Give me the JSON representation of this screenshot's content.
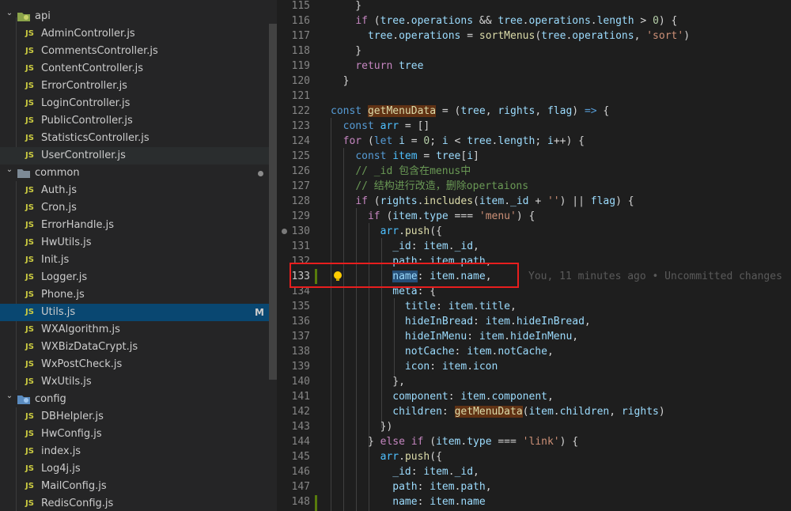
{
  "explorer": {
    "items": [
      {
        "type": "folder",
        "label": "api",
        "depth": 0,
        "icon": "api-folder-icon",
        "expanded": true
      },
      {
        "type": "file",
        "label": "AdminController.js",
        "depth": 1
      },
      {
        "type": "file",
        "label": "CommentsController.js",
        "depth": 1
      },
      {
        "type": "file",
        "label": "ContentController.js",
        "depth": 1
      },
      {
        "type": "file",
        "label": "ErrorController.js",
        "depth": 1
      },
      {
        "type": "file",
        "label": "LoginController.js",
        "depth": 1
      },
      {
        "type": "file",
        "label": "PublicController.js",
        "depth": 1
      },
      {
        "type": "file",
        "label": "StatisticsController.js",
        "depth": 1
      },
      {
        "type": "file",
        "label": "UserController.js",
        "depth": 1,
        "state": "hover"
      },
      {
        "type": "folder",
        "label": "common",
        "depth": 0,
        "icon": "folder-icon",
        "expanded": true,
        "modified_dot": true
      },
      {
        "type": "file",
        "label": "Auth.js",
        "depth": 1
      },
      {
        "type": "file",
        "label": "Cron.js",
        "depth": 1
      },
      {
        "type": "file",
        "label": "ErrorHandle.js",
        "depth": 1
      },
      {
        "type": "file",
        "label": "HwUtils.js",
        "depth": 1
      },
      {
        "type": "file",
        "label": "Init.js",
        "depth": 1
      },
      {
        "type": "file",
        "label": "Logger.js",
        "depth": 1
      },
      {
        "type": "file",
        "label": "Phone.js",
        "depth": 1
      },
      {
        "type": "file",
        "label": "Utils.js",
        "depth": 1,
        "state": "selected",
        "badge": "M"
      },
      {
        "type": "file",
        "label": "WXAlgorithm.js",
        "depth": 1
      },
      {
        "type": "file",
        "label": "WXBizDataCrypt.js",
        "depth": 1
      },
      {
        "type": "file",
        "label": "WxPostCheck.js",
        "depth": 1
      },
      {
        "type": "file",
        "label": "WxUtils.js",
        "depth": 1
      },
      {
        "type": "folder",
        "label": "config",
        "depth": 0,
        "icon": "config-folder-icon",
        "expanded": true
      },
      {
        "type": "file",
        "label": "DBHelpler.js",
        "depth": 1
      },
      {
        "type": "file",
        "label": "HwConfig.js",
        "depth": 1
      },
      {
        "type": "file",
        "label": "index.js",
        "depth": 1
      },
      {
        "type": "file",
        "label": "Log4j.js",
        "depth": 1
      },
      {
        "type": "file",
        "label": "MailConfig.js",
        "depth": 1
      },
      {
        "type": "file",
        "label": "RedisConfig.js",
        "depth": 1
      }
    ],
    "js_badge": "JS"
  },
  "editor": {
    "active_line": "133",
    "blame": "You, 11 minutes ago • Uncommitted changes",
    "lines": [
      {
        "n": "115",
        "t": [
          [
            "o",
            "    }"
          ]
        ]
      },
      {
        "n": "116",
        "t": [
          [
            "o",
            "    "
          ],
          [
            "k",
            "if"
          ],
          [
            "o",
            " ("
          ],
          [
            "v",
            "tree"
          ],
          [
            "o",
            "."
          ],
          [
            "v",
            "operations"
          ],
          [
            "o",
            " && "
          ],
          [
            "v",
            "tree"
          ],
          [
            "o",
            "."
          ],
          [
            "v",
            "operations"
          ],
          [
            "o",
            "."
          ],
          [
            "v",
            "length"
          ],
          [
            "o",
            " > "
          ],
          [
            "n",
            "0"
          ],
          [
            "o",
            ") {"
          ]
        ]
      },
      {
        "n": "117",
        "t": [
          [
            "o",
            "      "
          ],
          [
            "v",
            "tree"
          ],
          [
            "o",
            "."
          ],
          [
            "v",
            "operations"
          ],
          [
            "o",
            " = "
          ],
          [
            "f",
            "sortMenus"
          ],
          [
            "o",
            "("
          ],
          [
            "v",
            "tree"
          ],
          [
            "o",
            "."
          ],
          [
            "v",
            "operations"
          ],
          [
            "o",
            ", "
          ],
          [
            "str",
            "'sort'"
          ],
          [
            "o",
            ")"
          ]
        ]
      },
      {
        "n": "118",
        "t": [
          [
            "o",
            "    }"
          ]
        ]
      },
      {
        "n": "119",
        "t": [
          [
            "o",
            "    "
          ],
          [
            "k",
            "return"
          ],
          [
            "o",
            " "
          ],
          [
            "v",
            "tree"
          ]
        ]
      },
      {
        "n": "120",
        "t": [
          [
            "o",
            "  }"
          ]
        ]
      },
      {
        "n": "121",
        "t": []
      },
      {
        "n": "122",
        "t": [
          [
            "s",
            "const"
          ],
          [
            "o",
            " "
          ],
          [
            "fhl",
            "getMenuData"
          ],
          [
            "o",
            " = ("
          ],
          [
            "v",
            "tree"
          ],
          [
            "o",
            ", "
          ],
          [
            "v",
            "rights"
          ],
          [
            "o",
            ", "
          ],
          [
            "v",
            "flag"
          ],
          [
            "o",
            ") "
          ],
          [
            "s",
            "=>"
          ],
          [
            "o",
            " {"
          ]
        ]
      },
      {
        "n": "123",
        "t": [
          [
            "o",
            "  "
          ],
          [
            "s",
            "const"
          ],
          [
            "o",
            " "
          ],
          [
            "c",
            "arr"
          ],
          [
            "o",
            " = []"
          ]
        ]
      },
      {
        "n": "124",
        "t": [
          [
            "o",
            "  "
          ],
          [
            "k",
            "for"
          ],
          [
            "o",
            " ("
          ],
          [
            "s",
            "let"
          ],
          [
            "o",
            " "
          ],
          [
            "v",
            "i"
          ],
          [
            "o",
            " = "
          ],
          [
            "n",
            "0"
          ],
          [
            "o",
            "; "
          ],
          [
            "v",
            "i"
          ],
          [
            "o",
            " < "
          ],
          [
            "v",
            "tree"
          ],
          [
            "o",
            "."
          ],
          [
            "v",
            "length"
          ],
          [
            "o",
            "; "
          ],
          [
            "v",
            "i"
          ],
          [
            "o",
            "++) {"
          ]
        ]
      },
      {
        "n": "125",
        "t": [
          [
            "o",
            "    "
          ],
          [
            "s",
            "const"
          ],
          [
            "o",
            " "
          ],
          [
            "c",
            "item"
          ],
          [
            "o",
            " = "
          ],
          [
            "v",
            "tree"
          ],
          [
            "o",
            "["
          ],
          [
            "v",
            "i"
          ],
          [
            "o",
            "]"
          ]
        ]
      },
      {
        "n": "126",
        "t": [
          [
            "o",
            "    "
          ],
          [
            "cm",
            "// _id 包含在menus中"
          ]
        ]
      },
      {
        "n": "127",
        "t": [
          [
            "o",
            "    "
          ],
          [
            "cm",
            "// 结构进行改造，删除opertaions"
          ]
        ]
      },
      {
        "n": "128",
        "t": [
          [
            "o",
            "    "
          ],
          [
            "k",
            "if"
          ],
          [
            "o",
            " ("
          ],
          [
            "v",
            "rights"
          ],
          [
            "o",
            "."
          ],
          [
            "f",
            "includes"
          ],
          [
            "o",
            "("
          ],
          [
            "v",
            "item"
          ],
          [
            "o",
            "."
          ],
          [
            "v",
            "_id"
          ],
          [
            "o",
            " + "
          ],
          [
            "str",
            "''"
          ],
          [
            "o",
            ") || "
          ],
          [
            "v",
            "flag"
          ],
          [
            "o",
            ") {"
          ]
        ]
      },
      {
        "n": "129",
        "t": [
          [
            "o",
            "      "
          ],
          [
            "k",
            "if"
          ],
          [
            "o",
            " ("
          ],
          [
            "v",
            "item"
          ],
          [
            "o",
            "."
          ],
          [
            "v",
            "type"
          ],
          [
            "o",
            " === "
          ],
          [
            "str",
            "'menu'"
          ],
          [
            "o",
            ") {"
          ]
        ]
      },
      {
        "n": "130",
        "t": [
          [
            "o",
            "        "
          ],
          [
            "c",
            "arr"
          ],
          [
            "o",
            "."
          ],
          [
            "f",
            "push"
          ],
          [
            "o",
            "({"
          ]
        ],
        "dot": true
      },
      {
        "n": "131",
        "t": [
          [
            "o",
            "          "
          ],
          [
            "v",
            "_id"
          ],
          [
            "o",
            ": "
          ],
          [
            "v",
            "item"
          ],
          [
            "o",
            "."
          ],
          [
            "v",
            "_id"
          ],
          [
            "o",
            ","
          ]
        ]
      },
      {
        "n": "132",
        "t": [
          [
            "o",
            "          "
          ],
          [
            "v",
            "path"
          ],
          [
            "o",
            ": "
          ],
          [
            "v",
            "item"
          ],
          [
            "o",
            "."
          ],
          [
            "v",
            "path"
          ],
          [
            "o",
            ","
          ]
        ]
      },
      {
        "n": "133",
        "t": [
          [
            "o",
            "          "
          ],
          [
            "vsel",
            "name"
          ],
          [
            "o",
            ": "
          ],
          [
            "v",
            "item"
          ],
          [
            "o",
            "."
          ],
          [
            "v",
            "name"
          ],
          [
            "o",
            ","
          ]
        ],
        "active": true
      },
      {
        "n": "134",
        "t": [
          [
            "o",
            "          "
          ],
          [
            "v",
            "meta"
          ],
          [
            "o",
            ": {"
          ]
        ]
      },
      {
        "n": "135",
        "t": [
          [
            "o",
            "            "
          ],
          [
            "v",
            "title"
          ],
          [
            "o",
            ": "
          ],
          [
            "v",
            "item"
          ],
          [
            "o",
            "."
          ],
          [
            "v",
            "title"
          ],
          [
            "o",
            ","
          ]
        ]
      },
      {
        "n": "136",
        "t": [
          [
            "o",
            "            "
          ],
          [
            "v",
            "hideInBread"
          ],
          [
            "o",
            ": "
          ],
          [
            "v",
            "item"
          ],
          [
            "o",
            "."
          ],
          [
            "v",
            "hideInBread"
          ],
          [
            "o",
            ","
          ]
        ]
      },
      {
        "n": "137",
        "t": [
          [
            "o",
            "            "
          ],
          [
            "v",
            "hideInMenu"
          ],
          [
            "o",
            ": "
          ],
          [
            "v",
            "item"
          ],
          [
            "o",
            "."
          ],
          [
            "v",
            "hideInMenu"
          ],
          [
            "o",
            ","
          ]
        ]
      },
      {
        "n": "138",
        "t": [
          [
            "o",
            "            "
          ],
          [
            "v",
            "notCache"
          ],
          [
            "o",
            ": "
          ],
          [
            "v",
            "item"
          ],
          [
            "o",
            "."
          ],
          [
            "v",
            "notCache"
          ],
          [
            "o",
            ","
          ]
        ]
      },
      {
        "n": "139",
        "t": [
          [
            "o",
            "            "
          ],
          [
            "v",
            "icon"
          ],
          [
            "o",
            ": "
          ],
          [
            "v",
            "item"
          ],
          [
            "o",
            "."
          ],
          [
            "v",
            "icon"
          ]
        ]
      },
      {
        "n": "140",
        "t": [
          [
            "o",
            "          },"
          ]
        ]
      },
      {
        "n": "141",
        "t": [
          [
            "o",
            "          "
          ],
          [
            "v",
            "component"
          ],
          [
            "o",
            ": "
          ],
          [
            "v",
            "item"
          ],
          [
            "o",
            "."
          ],
          [
            "v",
            "component"
          ],
          [
            "o",
            ","
          ]
        ]
      },
      {
        "n": "142",
        "t": [
          [
            "o",
            "          "
          ],
          [
            "v",
            "children"
          ],
          [
            "o",
            ": "
          ],
          [
            "fhl",
            "getMenuData"
          ],
          [
            "o",
            "("
          ],
          [
            "v",
            "item"
          ],
          [
            "o",
            "."
          ],
          [
            "v",
            "children"
          ],
          [
            "o",
            ", "
          ],
          [
            "v",
            "rights"
          ],
          [
            "o",
            ")"
          ]
        ]
      },
      {
        "n": "143",
        "t": [
          [
            "o",
            "        })"
          ]
        ]
      },
      {
        "n": "144",
        "t": [
          [
            "o",
            "      } "
          ],
          [
            "k",
            "else"
          ],
          [
            "o",
            " "
          ],
          [
            "k",
            "if"
          ],
          [
            "o",
            " ("
          ],
          [
            "v",
            "item"
          ],
          [
            "o",
            "."
          ],
          [
            "v",
            "type"
          ],
          [
            "o",
            " === "
          ],
          [
            "str",
            "'link'"
          ],
          [
            "o",
            ") {"
          ]
        ]
      },
      {
        "n": "145",
        "t": [
          [
            "o",
            "        "
          ],
          [
            "c",
            "arr"
          ],
          [
            "o",
            "."
          ],
          [
            "f",
            "push"
          ],
          [
            "o",
            "({"
          ]
        ]
      },
      {
        "n": "146",
        "t": [
          [
            "o",
            "          "
          ],
          [
            "v",
            "_id"
          ],
          [
            "o",
            ": "
          ],
          [
            "v",
            "item"
          ],
          [
            "o",
            "."
          ],
          [
            "v",
            "_id"
          ],
          [
            "o",
            ","
          ]
        ]
      },
      {
        "n": "147",
        "t": [
          [
            "o",
            "          "
          ],
          [
            "v",
            "path"
          ],
          [
            "o",
            ": "
          ],
          [
            "v",
            "item"
          ],
          [
            "o",
            "."
          ],
          [
            "v",
            "path"
          ],
          [
            "o",
            ","
          ]
        ]
      },
      {
        "n": "148",
        "t": [
          [
            "o",
            "          "
          ],
          [
            "v",
            "name"
          ],
          [
            "o",
            ": "
          ],
          [
            "v",
            "item"
          ],
          [
            "o",
            "."
          ],
          [
            "v",
            "name"
          ]
        ]
      }
    ]
  },
  "colors": {
    "sidebar_bg": "#252526",
    "editor_bg": "#1e1e1e",
    "selection": "#094771",
    "annotation_box": "#e81e1e"
  }
}
